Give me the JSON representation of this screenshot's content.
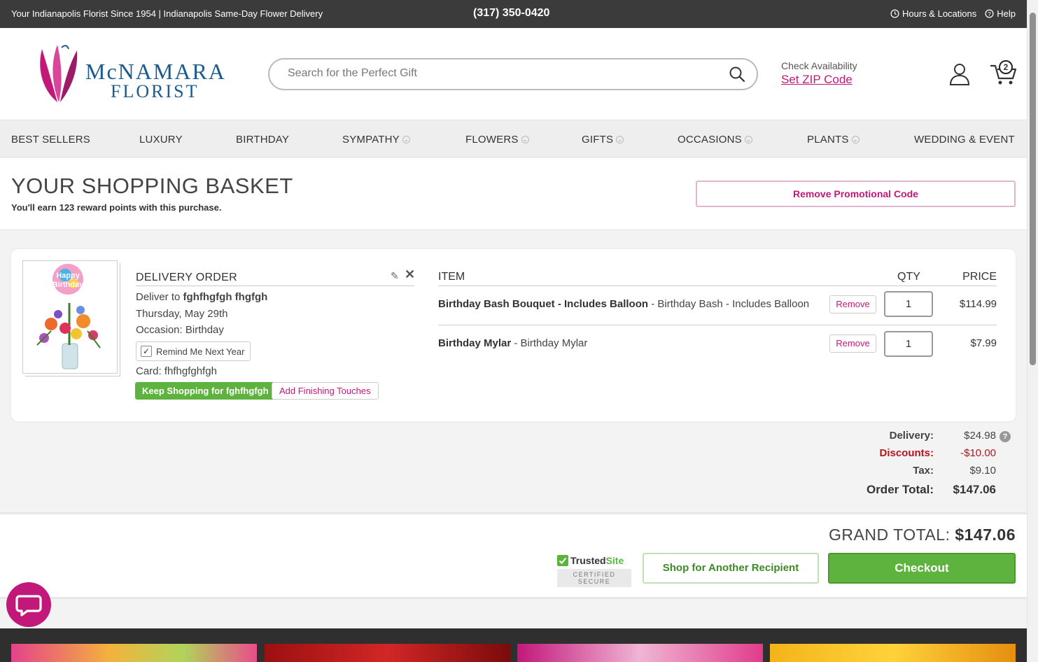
{
  "topbar": {
    "tagline": "Your Indianapolis Florist Since 1954 | Indianapolis Same-Day Flower Delivery",
    "phone": "(317) 350-0420",
    "hours": "Hours & Locations",
    "help": "Help"
  },
  "header": {
    "logo_line1": "McNAMARA",
    "logo_line2": "FLORIST",
    "search_placeholder": "Search for the Perfect Gift",
    "check_availability": "Check Availability",
    "set_zip": "Set ZIP Code",
    "cart_count": "2"
  },
  "nav": [
    "BEST SELLERS",
    "LUXURY",
    "BIRTHDAY",
    "SYMPATHY",
    "FLOWERS",
    "GIFTS",
    "OCCASIONS",
    "PLANTS",
    "WEDDING & EVENT"
  ],
  "basket": {
    "title": "YOUR SHOPPING BASKET",
    "points": "You'll earn 123 reward points with this purchase.",
    "remove_promo": "Remove Promotional Code"
  },
  "delivery": {
    "title": "DELIVERY ORDER",
    "deliver_to_prefix": "Deliver to ",
    "recipient": "fghfhgfgh fhgfgh",
    "date": "Thursday, May 29th",
    "occasion": "Occasion: Birthday",
    "remind": "Remind Me Next Year",
    "card": "Card: fhfhgfghfgh",
    "keep_shopping": "Keep Shopping for fghfhgfgh",
    "add_touches": "Add Finishing Touches",
    "balloon_text1": "Happy",
    "balloon_text2": "Birthday"
  },
  "items_header": {
    "item": "ITEM",
    "qty": "QTY",
    "price": "PRICE"
  },
  "items": [
    {
      "name": "Birthday Bash Bouquet - Includes Balloon",
      "variant": " - Birthday Bash - Includes Balloon",
      "remove": "Remove",
      "qty": "1",
      "price": "$114.99"
    },
    {
      "name": "Birthday Mylar",
      "variant": " - Birthday Mylar",
      "remove": "Remove",
      "qty": "1",
      "price": "$7.99"
    }
  ],
  "totals": {
    "delivery_label": "Delivery:",
    "delivery": "$24.98",
    "discounts_label": "Discounts:",
    "discounts": "-$10.00",
    "tax_label": "Tax:",
    "tax": "$9.10",
    "order_total_label": "Order Total:",
    "order_total": "$147.06"
  },
  "footer": {
    "grand_label": "GRAND TOTAL: ",
    "grand_total": "$147.06",
    "trusted_a": "Trusted",
    "trusted_b": "Site",
    "certified": "CERTIFIED SECURE",
    "shop_another": "Shop for Another Recipient",
    "checkout": "Checkout"
  },
  "colors": {
    "accent": "#c2187a",
    "green": "#5db33e",
    "discount": "#b4151f",
    "logo_blue": "#1b5b8f"
  }
}
